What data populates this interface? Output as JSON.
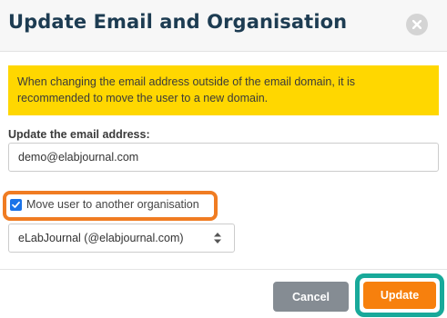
{
  "dialog": {
    "title": "Update Email and Organisation",
    "close_icon": "close-icon"
  },
  "alert": {
    "text": "When changing the email address outside of the email domain, it is recommended to move the user to a new domain."
  },
  "email": {
    "label": "Update the email address:",
    "value": "demo@elabjournal.com"
  },
  "move_user": {
    "label": "Move user to another organisation",
    "checked": true
  },
  "organisation": {
    "selected": "eLabJournal (@elabjournal.com)",
    "icon": "sort-arrows-icon"
  },
  "footer": {
    "cancel_label": "Cancel",
    "update_label": "Update"
  },
  "colors": {
    "title": "#1d3c52",
    "alert_bg": "#ffd700",
    "highlight_orange": "#f07c22",
    "highlight_teal": "#18a99a",
    "update_button": "#f7800d",
    "cancel_button": "#858c93",
    "checkbox": "#1a73e8"
  }
}
